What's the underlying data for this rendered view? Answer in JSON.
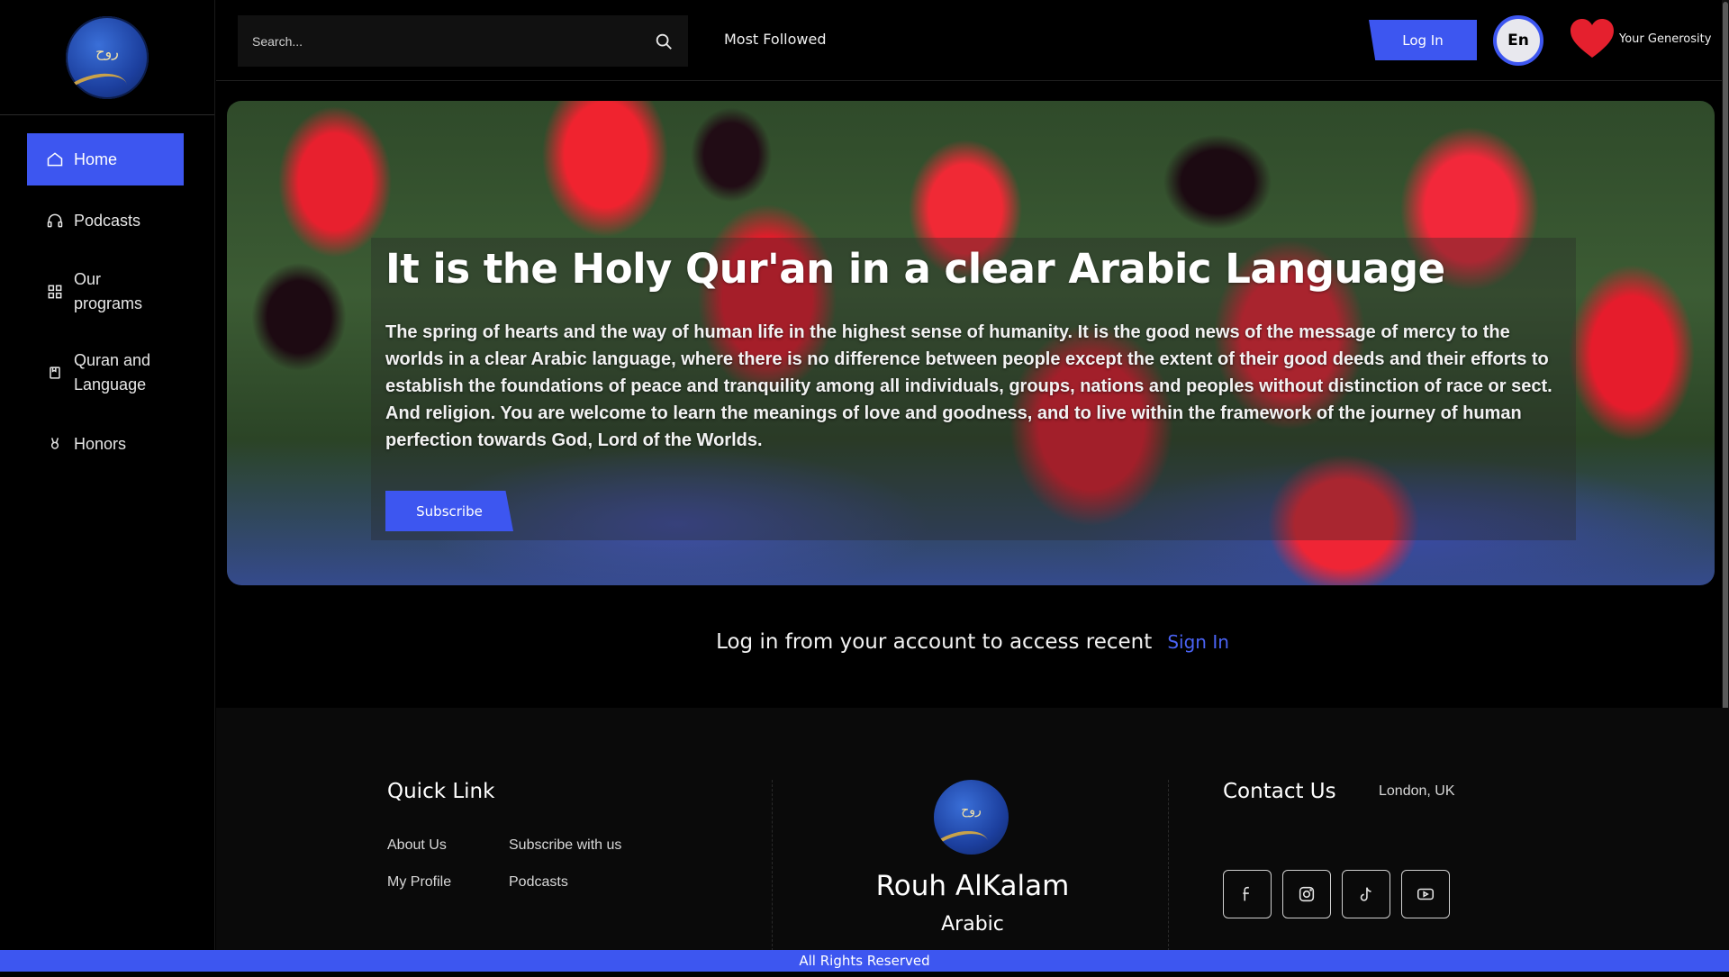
{
  "brand": {
    "logo_glyph": "روح",
    "name": "Rouh AlKalam",
    "subtitle": "Arabic"
  },
  "sidebar": {
    "items": [
      {
        "label": "Home",
        "icon": "home-icon",
        "active": true
      },
      {
        "label": "Podcasts",
        "icon": "headphones-icon"
      },
      {
        "label": "Our programs",
        "icon": "grid-icon"
      },
      {
        "label": "Quran and Language",
        "icon": "book-icon"
      },
      {
        "label": "Honors",
        "icon": "award-icon"
      }
    ]
  },
  "header": {
    "search_placeholder": "Search...",
    "most_followed": "Most Followed",
    "login_label": "Log In",
    "lang_label": "En",
    "donate_label": "Your Generosity"
  },
  "hero": {
    "title": "It is the Holy Qur'an in a clear Arabic Language",
    "text": "The spring of hearts and the way of human life in the highest sense of humanity. It is the good news of the message of mercy to the worlds in a clear Arabic language, where there is no difference between people except the extent of their good deeds and their efforts to establish the foundations of peace and tranquility among all individuals, groups, nations and peoples without distinction of race or sect. And religion. You are welcome to learn the meanings of love and goodness, and to live within the framework of the journey of human perfection towards God, Lord of the Worlds.",
    "subscribe_label": "Subscribe"
  },
  "recent": {
    "message": "Log in from your account to access recent",
    "sign_in": "Sign In"
  },
  "footer": {
    "quick_link_title": "Quick Link",
    "links": [
      "About Us",
      "Subscribe with us",
      "My Profile",
      "Podcasts"
    ],
    "contact_title": "Contact Us",
    "location": "London, UK",
    "socials": [
      "facebook-icon",
      "instagram-icon",
      "tiktok-icon",
      "youtube-icon"
    ],
    "rights": "All Rights Reserved"
  },
  "colors": {
    "accent": "#3d56f0",
    "background": "#000000",
    "footer_bg": "#0a0a0a",
    "heart": "#e5202e"
  }
}
